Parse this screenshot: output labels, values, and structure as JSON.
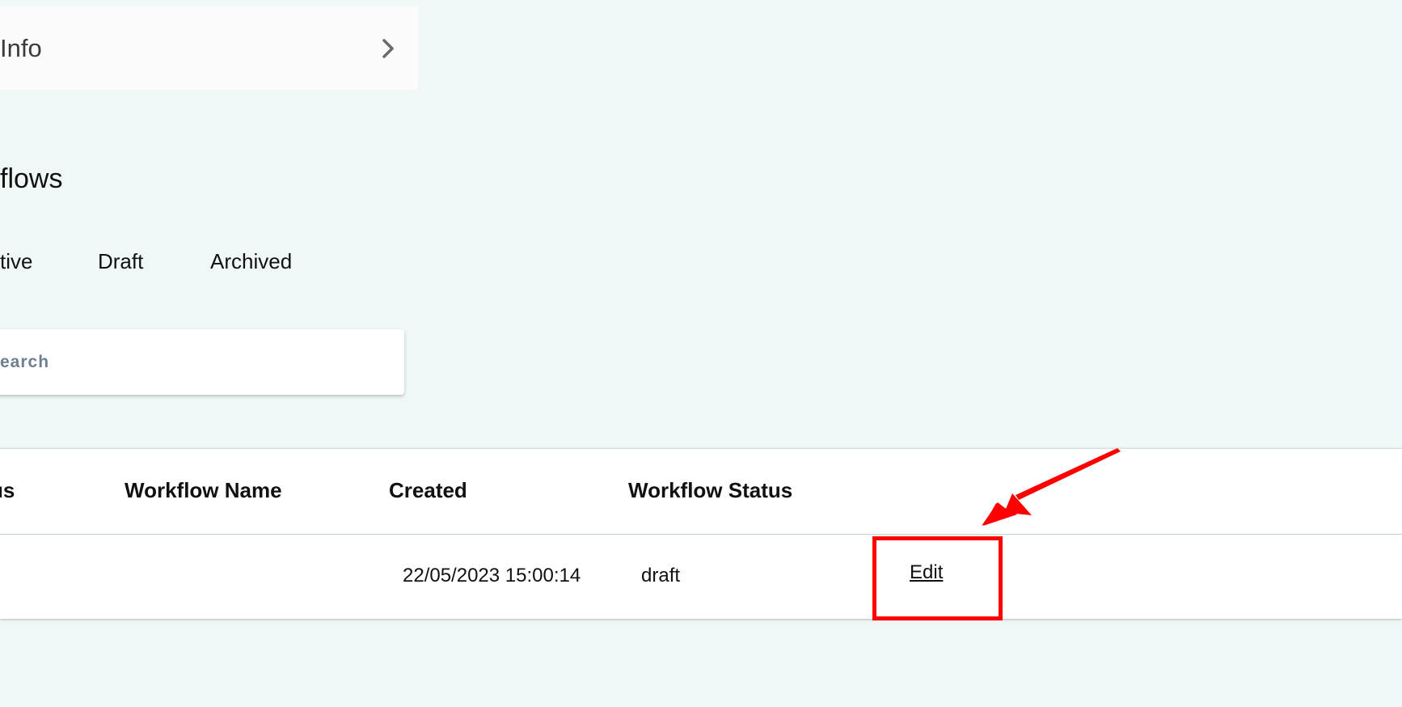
{
  "info_card": {
    "title": "Info",
    "chevron_icon": "chevron-right-icon"
  },
  "workflows": {
    "title": "flows",
    "tabs": [
      {
        "label": "tive"
      },
      {
        "label": "Draft"
      },
      {
        "label": "Archived"
      }
    ],
    "search": {
      "placeholder": "earch",
      "value": ""
    }
  },
  "table": {
    "headers": {
      "status": "us",
      "name": "Workflow Name",
      "created": "Created",
      "workflow_status": "Workflow Status"
    },
    "rows": [
      {
        "created": "22/05/2023 15:00:14",
        "workflow_status": "draft",
        "action": "Edit"
      }
    ]
  },
  "colors": {
    "page_background": "#eff8f7",
    "annotation": "#ff0000"
  }
}
